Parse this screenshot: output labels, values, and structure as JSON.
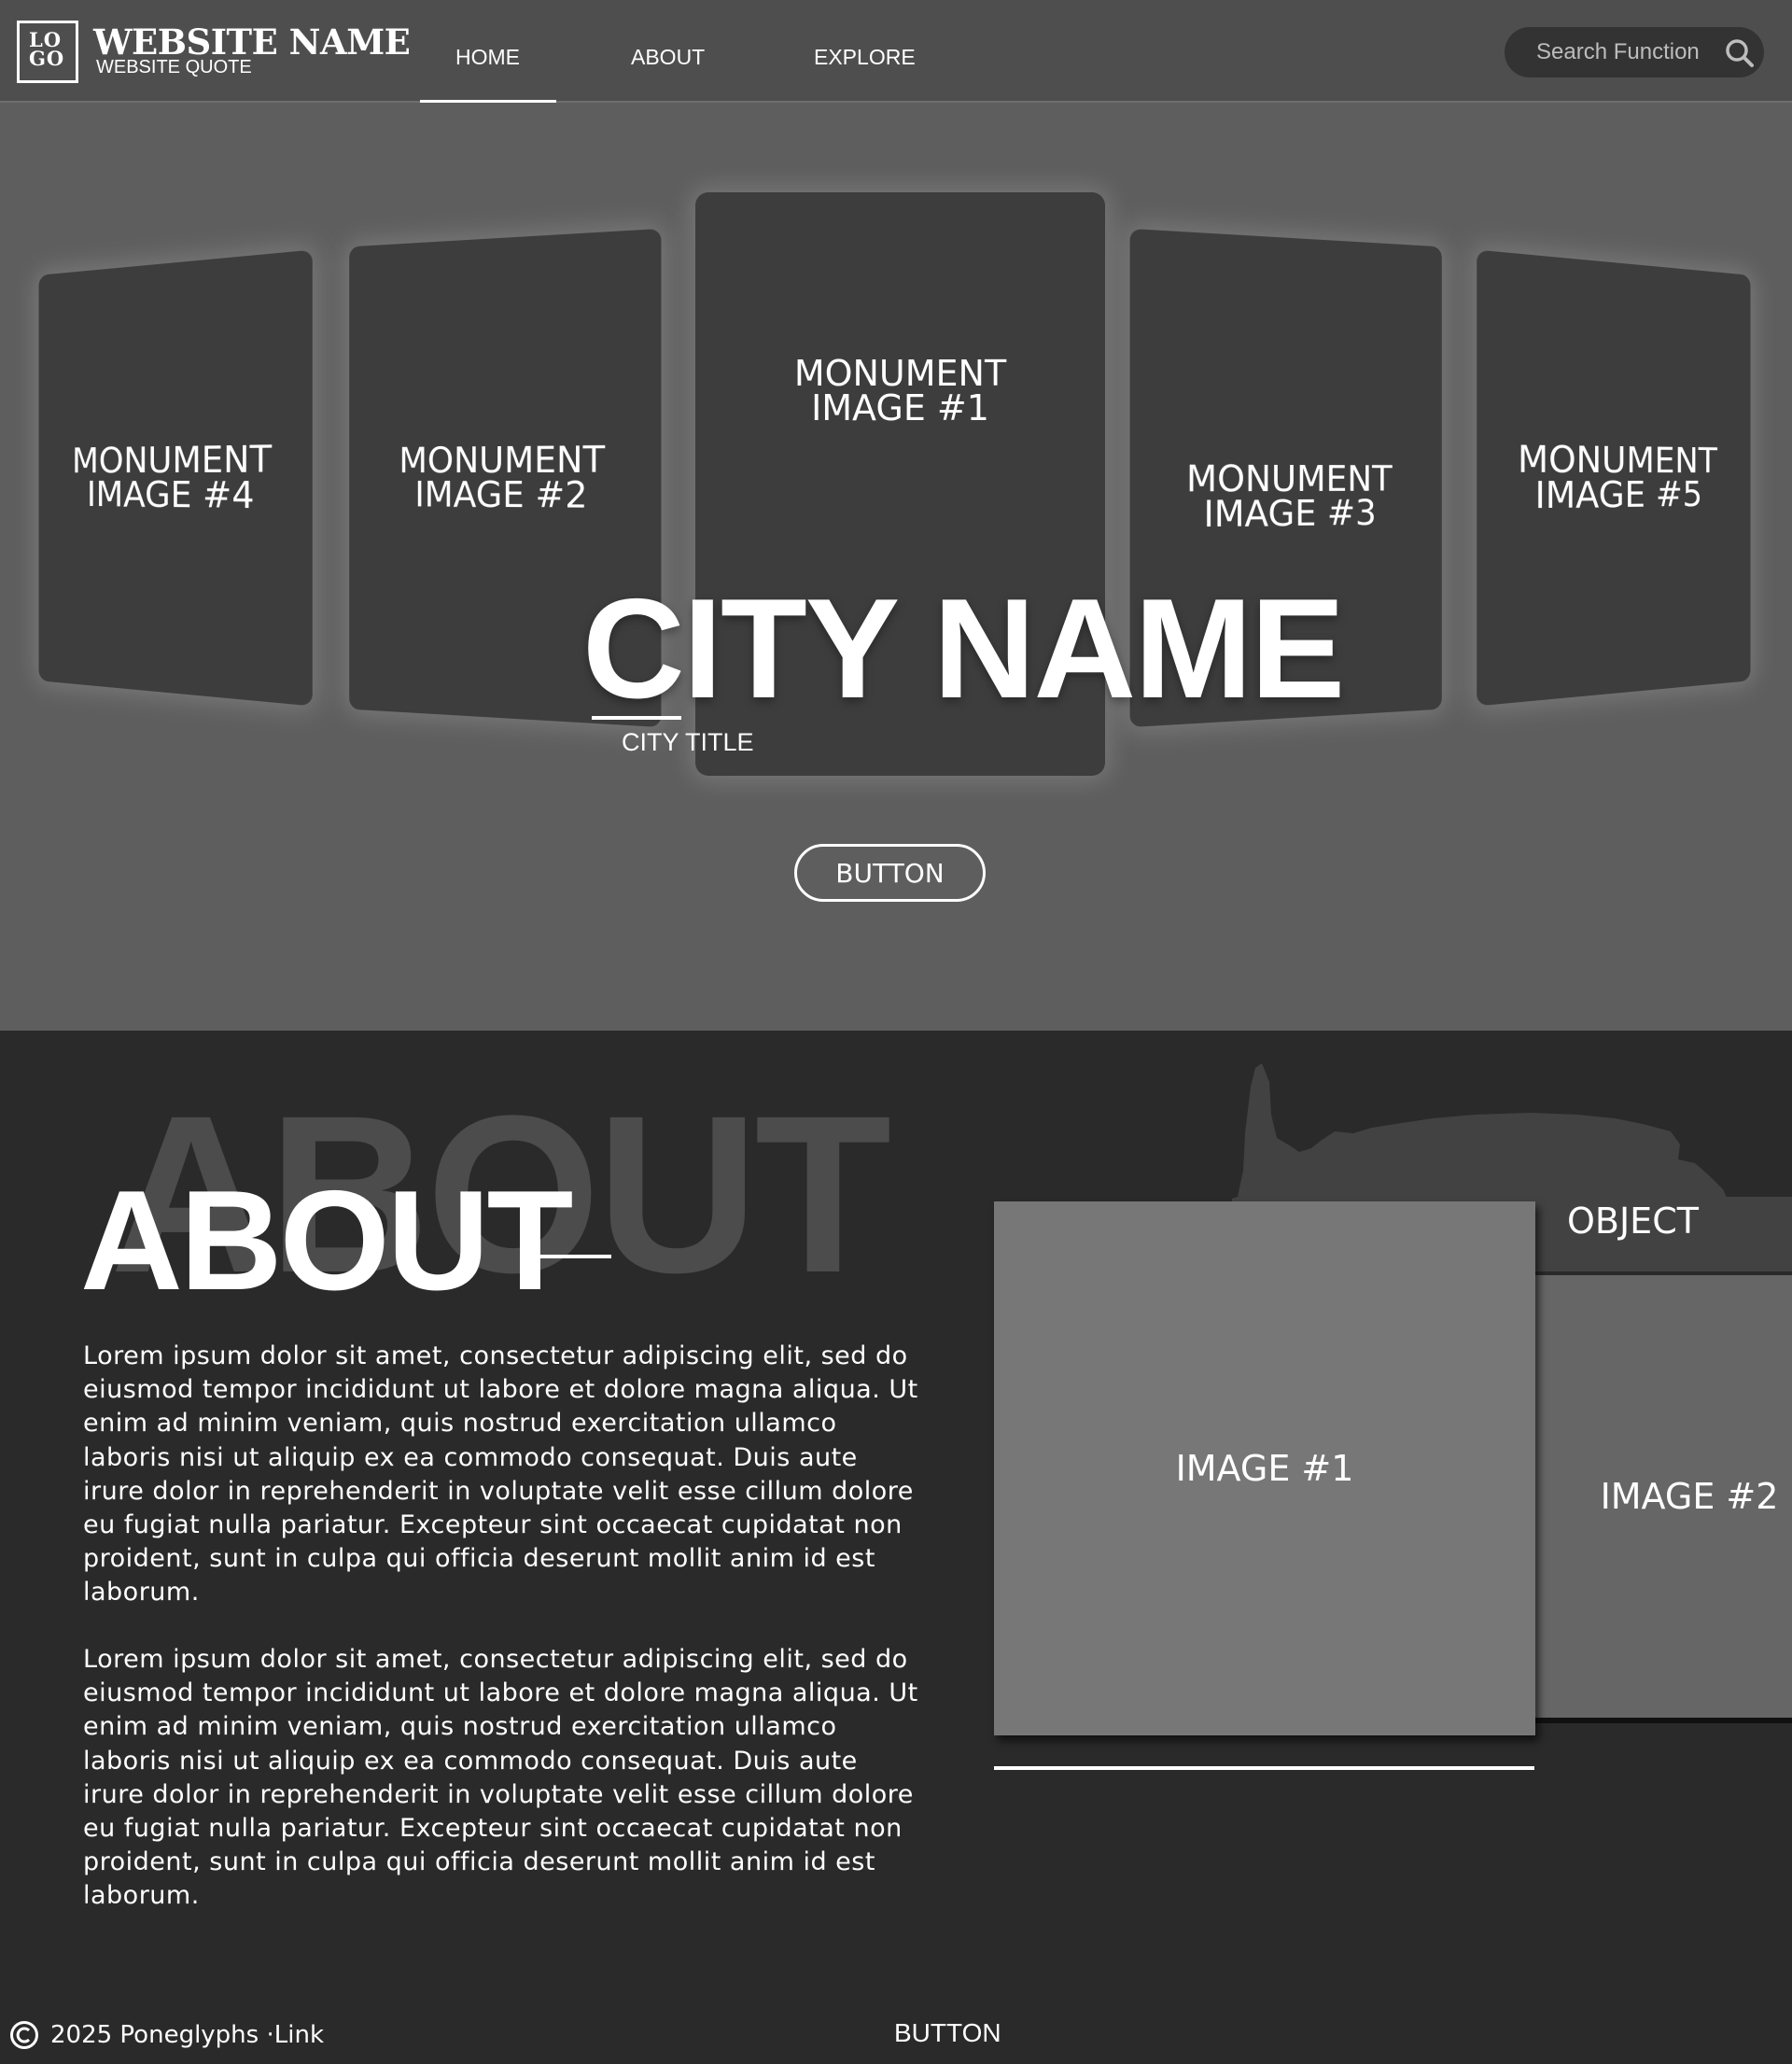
{
  "header": {
    "logo": {
      "line1": "LO",
      "line2": "GO"
    },
    "site_name": "WEBSITE NAME",
    "site_quote": "WEBSITE QUOTE",
    "nav": [
      {
        "label": "HOME",
        "active": true
      },
      {
        "label": "ABOUT",
        "active": false
      },
      {
        "label": "EXPLORE",
        "active": false
      }
    ],
    "search": {
      "placeholder": "Search Function",
      "icon": "search-icon"
    }
  },
  "hero": {
    "cards": {
      "card1": "MONUMENT IMAGE #1",
      "card2": "MONUMENT IMAGE #2",
      "card3": "MONUMENT IMAGE #3",
      "card4": "MONUMENT IMAGE #4",
      "card5": "MONUMENT IMAGE #5"
    },
    "city_name": "CITY NAME",
    "city_title": "CITY TITLE",
    "button_label": "BUTTON"
  },
  "about": {
    "background_word": "ABOUT",
    "heading": "ABOUT",
    "paragraphs": [
      "Lorem ipsum dolor sit amet, consectetur adipiscing elit, sed do eiusmod tempor incididunt ut labore et dolore magna aliqua. Ut enim ad minim veniam, quis nostrud exercitation ullamco laboris nisi ut aliquip ex ea commodo consequat. Duis aute irure dolor in reprehenderit in voluptate velit esse cillum dolore eu fugiat nulla pariatur. Excepteur sint occaecat cupidatat non proident, sunt in culpa qui officia deserunt mollit anim id est laborum.",
      "Lorem ipsum dolor sit amet, consectetur adipiscing elit, sed do eiusmod tempor incididunt ut labore et dolore magna aliqua. Ut enim ad minim veniam, quis nostrud exercitation ullamco laboris nisi ut aliquip ex ea commodo consequat. Duis aute irure dolor in reprehenderit in voluptate velit esse cillum dolore eu fugiat nulla pariatur. Excepteur sint occaecat cupidatat non proident, sunt in culpa qui officia deserunt mollit anim id est laborum."
    ],
    "object_label": "OBJECT",
    "image1_label": "IMAGE #1",
    "image2_label": "IMAGE #2"
  },
  "footer": {
    "copyright": "2025 Poneglyphs · ",
    "link_label": "Link",
    "button_label": "BUTTON"
  },
  "colors": {
    "header_bg": "#4e4e4e",
    "hero_bg": "#5e5e5e",
    "card_bg": "#3d3d3d",
    "about_bg": "#2a2a2a",
    "accent": "#ffffff"
  }
}
